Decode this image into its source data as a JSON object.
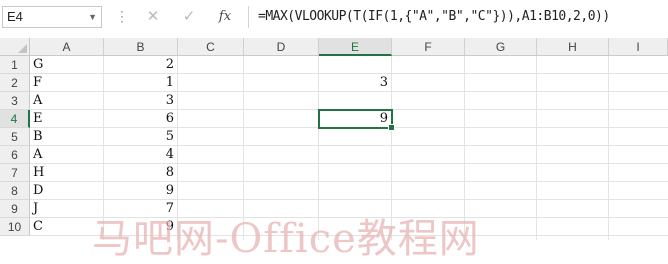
{
  "formula_bar": {
    "name_box": "E4",
    "cancel_glyph": "✕",
    "enter_glyph": "✓",
    "fx_label": "fx",
    "formula": "=MAX(VLOOKUP(T(IF(1,{\"A\",\"B\",\"C\"})),A1:B10,2,0))"
  },
  "columns": [
    "A",
    "B",
    "C",
    "D",
    "E",
    "F",
    "G",
    "H",
    "I"
  ],
  "rows": [
    "1",
    "2",
    "3",
    "4",
    "5",
    "6",
    "7",
    "8",
    "9",
    "10"
  ],
  "column_a": [
    "G",
    "F",
    "A",
    "E",
    "B",
    "A",
    "H",
    "D",
    "J",
    "C"
  ],
  "column_b": [
    "2",
    "1",
    "3",
    "6",
    "5",
    "4",
    "8",
    "9",
    "7",
    "9"
  ],
  "e2": "3",
  "e4": "9",
  "watermark": "马吧网-Office教程网",
  "colors": {
    "accent": "#217346",
    "watermark": "#e8b4b4"
  }
}
